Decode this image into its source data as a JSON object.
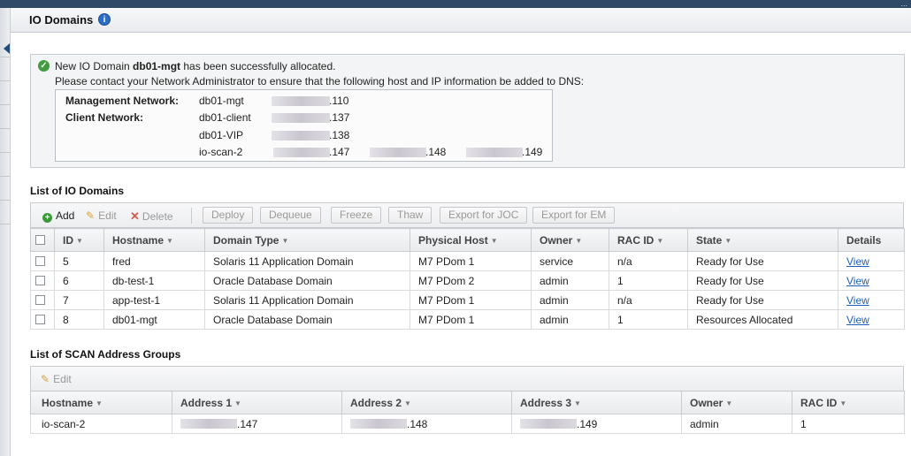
{
  "page": {
    "title": "IO Domains",
    "corner_text": "..."
  },
  "message": {
    "line1_prefix": "New IO Domain ",
    "line1_bold": "db01-mgt",
    "line1_suffix": " has been successfully allocated.",
    "line2": "Please contact your Network Administrator to ensure that the following host and IP information be added to DNS:",
    "labels": {
      "management": "Management Network:",
      "client": "Client Network:"
    },
    "hosts": [
      {
        "name": "db01-mgt",
        "ips": [
          ".110"
        ]
      },
      {
        "name": "db01-client",
        "ips": [
          ".137"
        ]
      },
      {
        "name": "db01-VIP",
        "ips": [
          ".138"
        ]
      },
      {
        "name": "io-scan-2",
        "ips": [
          ".147",
          ".148",
          ".149"
        ]
      }
    ]
  },
  "io_domains": {
    "section_title": "List of IO Domains",
    "toolbar": {
      "add": "Add",
      "edit": "Edit",
      "delete": "Delete",
      "deploy": "Deploy",
      "dequeue": "Dequeue",
      "freeze": "Freeze",
      "thaw": "Thaw",
      "export_joc": "Export for JOC",
      "export_em": "Export for EM"
    },
    "columns": [
      "ID",
      "Hostname",
      "Domain Type",
      "Physical Host",
      "Owner",
      "RAC ID",
      "State",
      "Details"
    ],
    "rows": [
      {
        "id": "5",
        "hostname": "fred",
        "domain_type": "Solaris 11 Application Domain",
        "physical_host": "M7 PDom 1",
        "owner": "service",
        "rac_id": "n/a",
        "state": "Ready for Use",
        "details": "View"
      },
      {
        "id": "6",
        "hostname": "db-test-1",
        "domain_type": "Oracle Database Domain",
        "physical_host": "M7 PDom 2",
        "owner": "admin",
        "rac_id": "1",
        "state": "Ready for Use",
        "details": "View"
      },
      {
        "id": "7",
        "hostname": "app-test-1",
        "domain_type": "Solaris 11 Application Domain",
        "physical_host": "M7 PDom 1",
        "owner": "admin",
        "rac_id": "n/a",
        "state": "Ready for Use",
        "details": "View"
      },
      {
        "id": "8",
        "hostname": "db01-mgt",
        "domain_type": "Oracle Database Domain",
        "physical_host": "M7 PDom 1",
        "owner": "admin",
        "rac_id": "1",
        "state": "Resources Allocated",
        "details": "View"
      }
    ]
  },
  "scan_groups": {
    "section_title": "List of SCAN Address Groups",
    "toolbar": {
      "edit": "Edit"
    },
    "columns": [
      "Hostname",
      "Address 1",
      "Address 2",
      "Address 3",
      "Owner",
      "RAC ID"
    ],
    "rows": [
      {
        "hostname": "io-scan-2",
        "address1": ".147",
        "address2": ".148",
        "address3": ".149",
        "owner": "admin",
        "rac_id": "1"
      }
    ]
  },
  "colors": {
    "accent_link": "#1f5fb8",
    "success": "#3f9d3f",
    "info": "#2b6cc4",
    "top_strip": "#2e4a68"
  },
  "icons": [
    "info-icon",
    "success-icon",
    "add-icon",
    "edit-icon",
    "delete-icon",
    "sort-caret-icon",
    "collapse-arrow-icon"
  ]
}
